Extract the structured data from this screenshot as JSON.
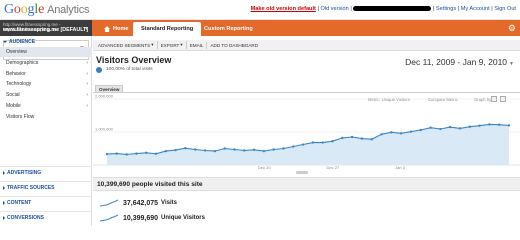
{
  "app": {
    "logo_word": "Google",
    "logo_product": "Analytics"
  },
  "topbar": {
    "make_default": "Make old version default",
    "separator": "|",
    "old_version": "Old version",
    "settings": "Settings",
    "my_account": "My Account",
    "sign_out": "Sign Out"
  },
  "account": {
    "url": "http://www.fitnessspring.me - http://www.fitnessspring.me",
    "profile": "www.fitnessspring.me [DEFAULT]"
  },
  "nav": {
    "home": "Home",
    "standard_reporting": "Standard Reporting",
    "custom_reporting": "Custom Reporting"
  },
  "toolbar": {
    "advanced_segments": "ADVANCED SEGMENTS",
    "export": "EXPORT",
    "email": "EMAIL",
    "add_to_dashboard": "ADD TO DASHBOARD"
  },
  "sidebar": {
    "audience": "AUDIENCE",
    "items": [
      {
        "label": "Overview",
        "active": true,
        "has_children": false
      },
      {
        "label": "Demographics",
        "active": false,
        "has_children": true
      },
      {
        "label": "Behavior",
        "active": false,
        "has_children": true
      },
      {
        "label": "Technology",
        "active": false,
        "has_children": true
      },
      {
        "label": "Social",
        "active": false,
        "has_children": true
      },
      {
        "label": "Mobile",
        "active": false,
        "has_children": true
      },
      {
        "label": "Visitors Flow",
        "active": false,
        "has_children": false
      }
    ],
    "sections": [
      "ADVERTISING",
      "TRAFFIC SOURCES",
      "CONTENT",
      "CONVERSIONS"
    ]
  },
  "page": {
    "title": "Visitors Overview",
    "percent_total": "100.00% of total visits",
    "date_range": "Dec 11, 2009 - Jan 9, 2010"
  },
  "chart_tabs": {
    "overview": "Overview",
    "metric_select": "Metric: Unique Visitors",
    "compare": "Compare Metric",
    "graph_by": "Graph by:"
  },
  "chart_data": {
    "type": "line",
    "series": [
      {
        "values": [
          330000,
          345000,
          320000,
          345000,
          370000,
          340000,
          420000,
          450000,
          510000,
          470000,
          440000,
          420000,
          500000,
          470000,
          440000,
          460000,
          420000,
          470000,
          500000,
          560000,
          620000,
          680000,
          680000,
          720000,
          820000,
          850000,
          800000,
          780000,
          930000,
          990000,
          960000,
          1010000,
          1060000,
          1130000,
          1090000,
          1150000,
          1110000,
          1160000,
          1190000,
          1230000,
          1220000,
          1200000
        ]
      }
    ],
    "y_ticks": [
      "2,000,000",
      "1,000,000"
    ],
    "x_ticks": [
      "Dec 20",
      "Dec 27",
      "Jan 3"
    ],
    "ylim": [
      0,
      2000000
    ],
    "color": "#3a86c7",
    "fill": "#d9e9f6",
    "grid": true
  },
  "summary": {
    "people_visited": "10,399,690 people visited this site"
  },
  "metrics": [
    {
      "value": "37,642,075",
      "label": "Visits"
    },
    {
      "value": "10,399,690",
      "label": "Unique Visitors"
    }
  ],
  "colors": {
    "nav_orange": "#e46a2b",
    "account_dark": "#3c3c3c",
    "link_blue": "#1a4fa0",
    "line_blue": "#3a86c7"
  }
}
